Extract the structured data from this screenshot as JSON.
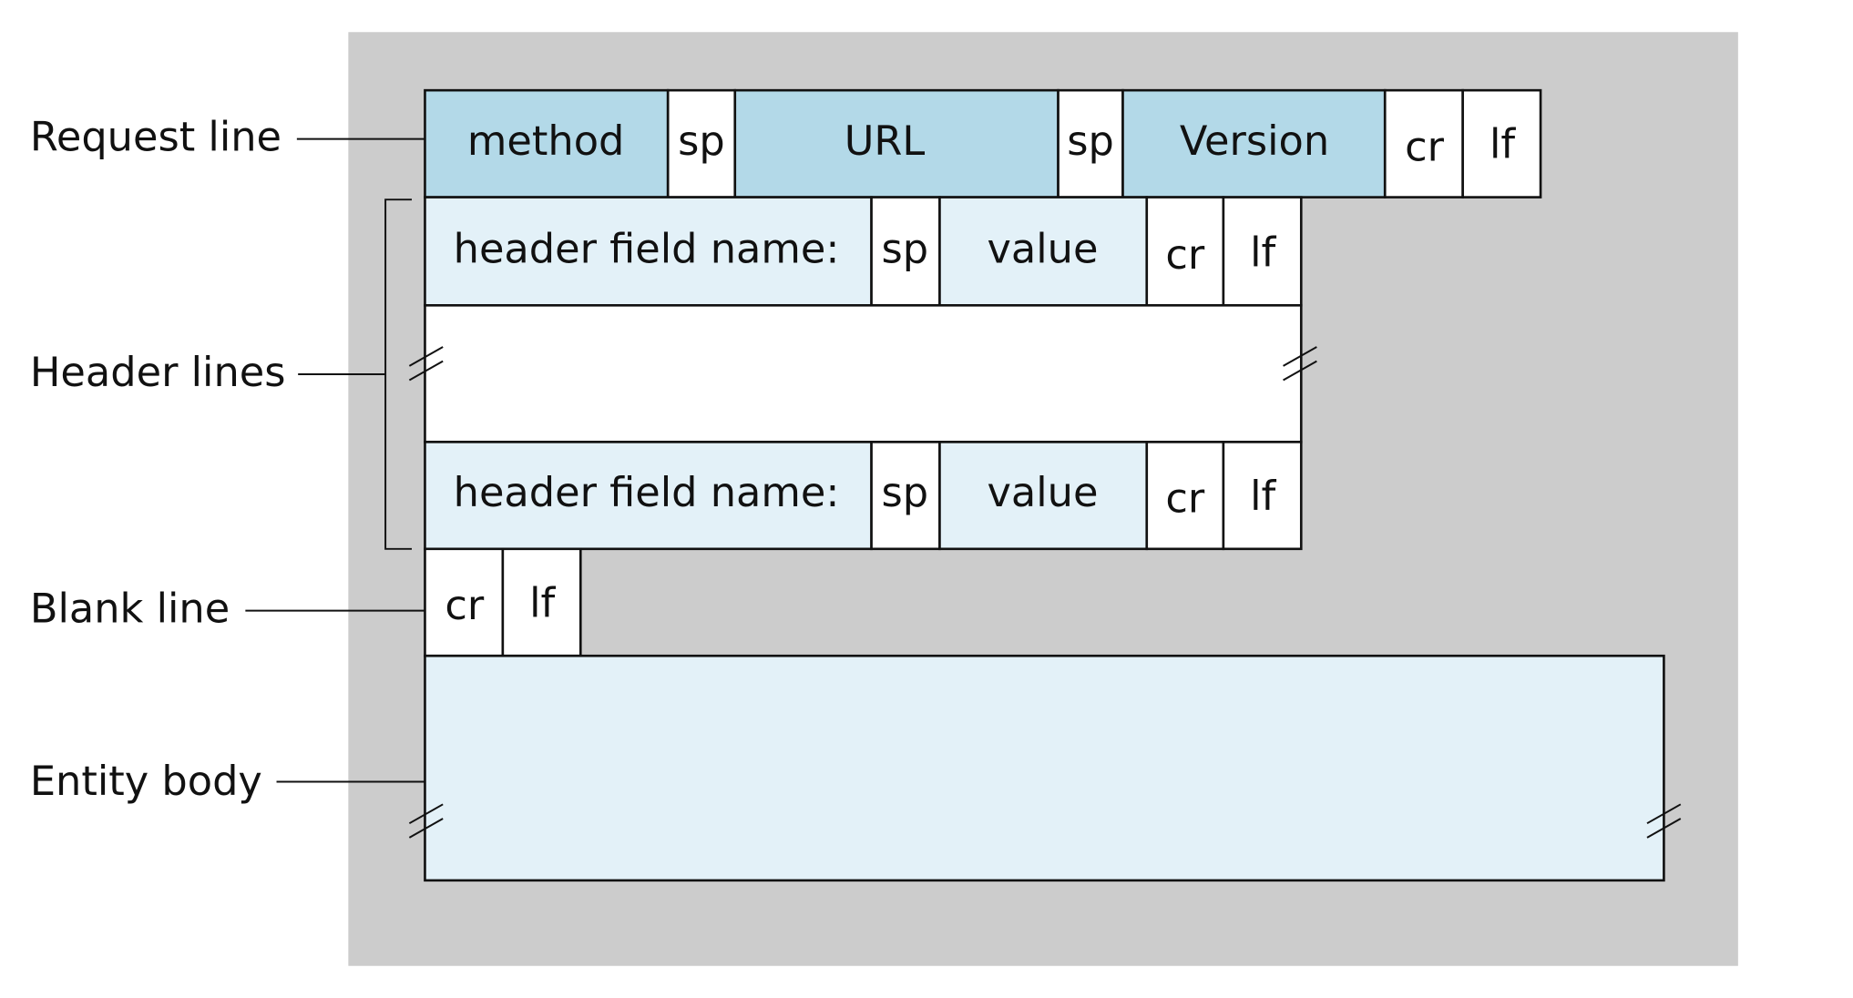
{
  "colors": {
    "background_panel": "#cccccc",
    "request_fill": "#b3d9e8",
    "header_fill": "#e3f1f8",
    "plain_fill": "#ffffff"
  },
  "labels": {
    "request_line": "Request line",
    "header_lines": "Header lines",
    "blank_line": "Blank line",
    "entity_body": "Entity body"
  },
  "request_line": [
    "method",
    "sp",
    "URL",
    "sp",
    "Version",
    "cr",
    "lf"
  ],
  "header_line_1": [
    "header field name:",
    "sp",
    "value",
    "cr",
    "lf"
  ],
  "header_line_2": [
    "header field name:",
    "sp",
    "value",
    "cr",
    "lf"
  ],
  "blank_line": [
    "cr",
    "lf"
  ]
}
